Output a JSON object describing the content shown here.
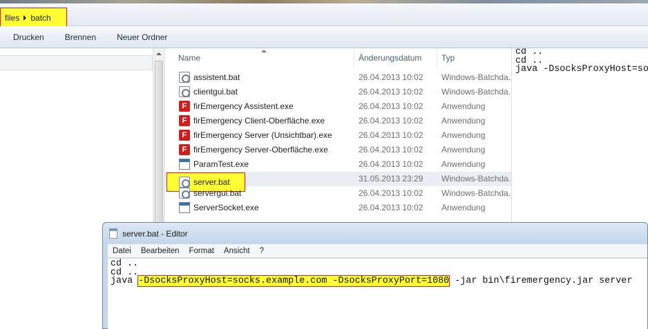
{
  "breadcrumb": {
    "items": [
      "files",
      "batch"
    ]
  },
  "toolbar": {
    "buttons": [
      "Drucken",
      "Brennen",
      "Neuer Ordner"
    ]
  },
  "filelist": {
    "columns": {
      "name": "Name",
      "date": "Änderungsdatum",
      "type": "Typ"
    },
    "rows": [
      {
        "name": "assistent.bat",
        "date": "26.04.2013 10:02",
        "type": "Windows-Batchda...",
        "icon": "batch-file-icon"
      },
      {
        "name": "clientgui.bat",
        "date": "26.04.2013 10:02",
        "type": "Windows-Batchda...",
        "icon": "batch-file-icon"
      },
      {
        "name": "firEmergency Assistent.exe",
        "date": "26.04.2013 10:02",
        "type": "Anwendung",
        "icon": "firemergency-app-icon"
      },
      {
        "name": "firEmergency Client-Oberfläche.exe",
        "date": "26.04.2013 10:02",
        "type": "Anwendung",
        "icon": "firemergency-app-icon"
      },
      {
        "name": "firEmergency Server (Unsichtbar).exe",
        "date": "26.04.2013 10:02",
        "type": "Anwendung",
        "icon": "firemergency-app-icon"
      },
      {
        "name": "firEmergency Server-Oberfläche.exe",
        "date": "26.04.2013 10:02",
        "type": "Anwendung",
        "icon": "firemergency-app-icon"
      },
      {
        "name": "ParamTest.exe",
        "date": "26.04.2013 10:02",
        "type": "Anwendung",
        "icon": "exe-window-icon"
      },
      {
        "name": "server.bat",
        "date": "31.05.2013 23:29",
        "type": "Windows-Batchda...",
        "icon": "batch-file-icon"
      },
      {
        "name": "servergui.bat",
        "date": "26.04.2013 10:02",
        "type": "Windows-Batchda...",
        "icon": "batch-file-icon"
      },
      {
        "name": "ServerSocket.exe",
        "date": "26.04.2013 10:02",
        "type": "Anwendung",
        "icon": "exe-window-icon"
      }
    ]
  },
  "preview": {
    "lines": [
      "cd ..",
      "cd ..",
      "java -DsocksProxyHost=socks"
    ]
  },
  "editor": {
    "title": "server.bat - Editor",
    "menu": [
      "Datei",
      "Bearbeiten",
      "Format",
      "Ansicht",
      "?"
    ],
    "line1": "cd ..",
    "line2": "cd ..",
    "line3_prefix": "java ",
    "line3_highlight": "-DsocksProxyHost=socks.example.com -DsocksProxyPort=1080",
    "line3_suffix": " -jar bin\\firemergency.jar server"
  },
  "colors": {
    "highlight": "#ffff33",
    "highlight_border": "#e81c1c",
    "firemergency_red": "#d21d1d"
  }
}
